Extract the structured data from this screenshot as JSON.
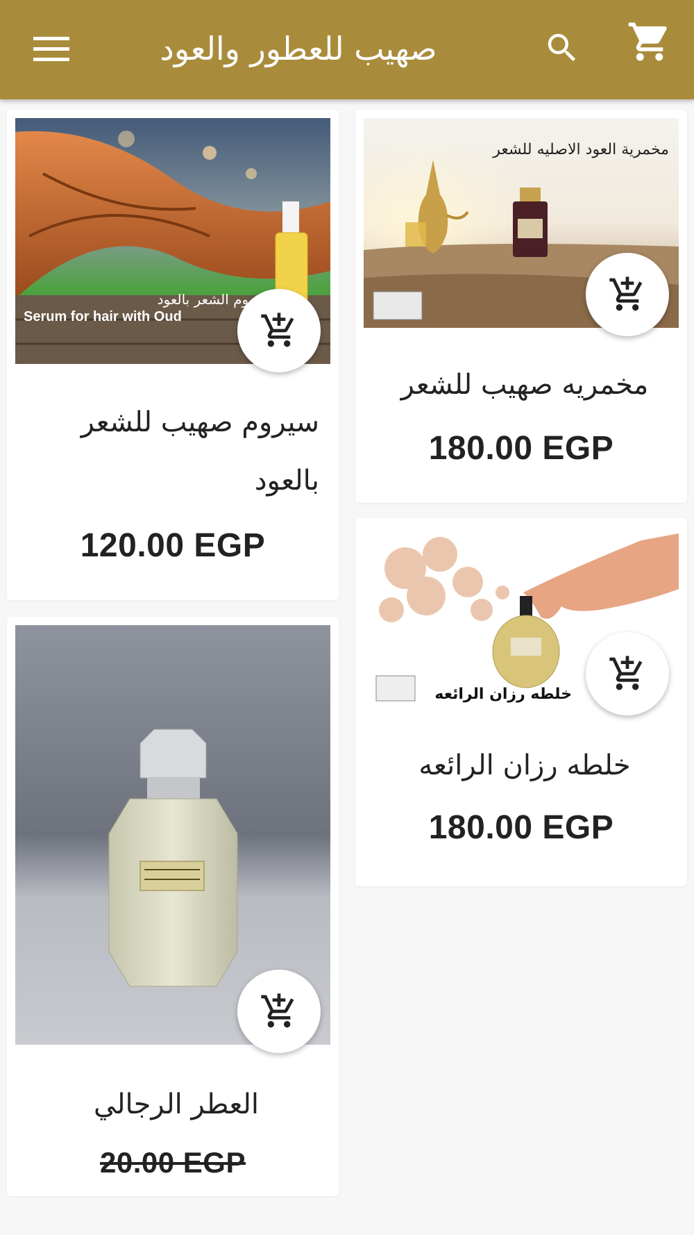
{
  "header": {
    "title": "صهيب للعطور والعود",
    "menu_icon": "menu-icon",
    "search_icon": "search-icon",
    "cart_icon": "cart-icon"
  },
  "products": [
    {
      "name": "مخمريه صهيب للشعر",
      "price": "180.00 EGP",
      "image_text": "مخمرية العود الاصليه للشعر",
      "icon": "add-to-cart-icon"
    },
    {
      "name": "سيروم صهيب للشعر بالعود",
      "price": "120.00 EGP",
      "image_text": "Serum for hair with Oud",
      "image_text_ar": "سيروم الشعر بالعود",
      "icon": "add-to-cart-icon"
    },
    {
      "name": "خلطه رزان الرائعه",
      "price": "180.00 EGP",
      "image_text": "خلطه رزان الرائعه",
      "icon": "add-to-cart-icon"
    },
    {
      "name": "العطر الرجالي",
      "price": "20.00 EGP",
      "price_struck": true,
      "icon": "add-to-cart-icon"
    }
  ],
  "colors": {
    "header": "#a98c3b",
    "background": "#f7f7f7"
  }
}
